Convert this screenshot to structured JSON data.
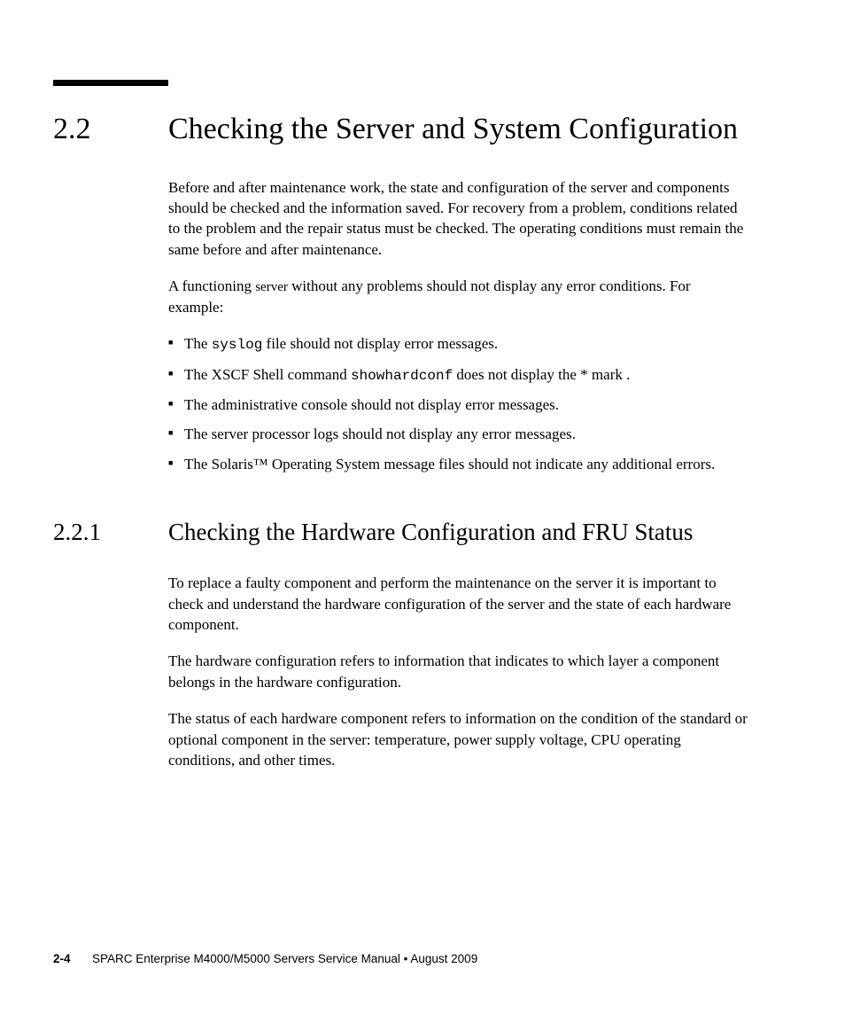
{
  "section": {
    "number": "2.2",
    "title": "Checking the Server and System Configuration",
    "intro_p1": "Before and after maintenance work, the state and configuration of the server and components should be checked and the information saved. For recovery from a problem, conditions related to the problem and the repair status must be checked. The operating conditions must remain the same before and after maintenance.",
    "intro_p2_a": "A functioning ",
    "intro_p2_server": "server",
    "intro_p2_b": " without any problems should not display any error conditions. For example:",
    "bullets": {
      "b1_a": "The ",
      "b1_code": "syslog",
      "b1_b": " file should not display error messages.",
      "b2_a": "The XSCF Shell command ",
      "b2_code": "showhardconf",
      "b2_b": " does not display the * mark .",
      "b3": "The administrative console should not display error messages.",
      "b4": "The server processor logs should not display any error messages.",
      "b5": "The Solaris™ Operating System message files should not indicate any additional errors."
    }
  },
  "subsection": {
    "number": "2.2.1",
    "title": "Checking the Hardware Configuration and FRU Status",
    "p1": "To replace a faulty component and perform the maintenance on the server it is important to check and understand the hardware configuration of the server and the state of each hardware component.",
    "p2": "The hardware configuration refers to information that indicates to which layer a component belongs in the hardware configuration.",
    "p3": "The status of each hardware component refers to information on the condition of the standard or optional component in the server: temperature, power supply voltage, CPU operating conditions, and other times."
  },
  "footer": {
    "pagenum": "2-4",
    "text": "SPARC Enterprise M4000/M5000 Servers Service Manual • August 2009"
  }
}
